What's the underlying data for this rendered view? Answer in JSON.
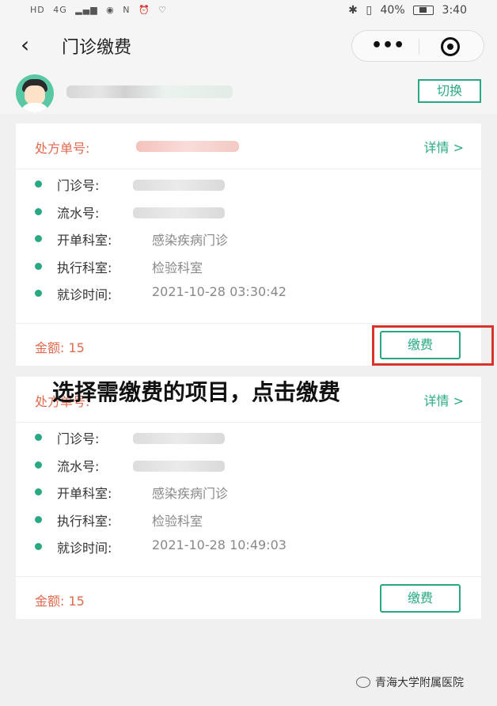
{
  "status_bar": {
    "left_icons": [
      "HD",
      "4G",
      "signal",
      "eye",
      "N",
      "alarm",
      "heart"
    ],
    "battery": "40%",
    "battery_level": 0.4,
    "time": "3:40"
  },
  "nav": {
    "title": "门诊缴费",
    "back_icon": "back-icon",
    "more_icon": "•••",
    "close_icon": "target-icon"
  },
  "user": {
    "switch_label": "切换"
  },
  "cards": [
    {
      "rx_label": "处方单号:",
      "detail_label": "详情 >",
      "rows": [
        {
          "label": "门诊号:",
          "value": ""
        },
        {
          "label": "流水号:",
          "value": ""
        },
        {
          "label": "开单科室:",
          "value": "感染疾病门诊"
        },
        {
          "label": "执行科室:",
          "value": "检验科室"
        },
        {
          "label": "就诊时间:",
          "value": "2021-10-28 03:30:42"
        }
      ],
      "amount": "金额: 15",
      "pay_label": "缴费"
    },
    {
      "rx_label": "处方单号:",
      "detail_label": "详情 >",
      "rows": [
        {
          "label": "门诊号:",
          "value": ""
        },
        {
          "label": "流水号:",
          "value": ""
        },
        {
          "label": "开单科室:",
          "value": "感染疾病门诊"
        },
        {
          "label": "执行科室:",
          "value": "检验科室"
        },
        {
          "label": "就诊时间:",
          "value": "2021-10-28 10:49:03"
        }
      ],
      "amount": "金额: 15",
      "pay_label": "缴费"
    }
  ],
  "instruction": "选择需缴费的项目，点击缴费",
  "watermark": "青海大学附属医院",
  "colors": {
    "accent": "#28a983",
    "warn": "#e06a4f",
    "highlight": "#d9342b"
  }
}
